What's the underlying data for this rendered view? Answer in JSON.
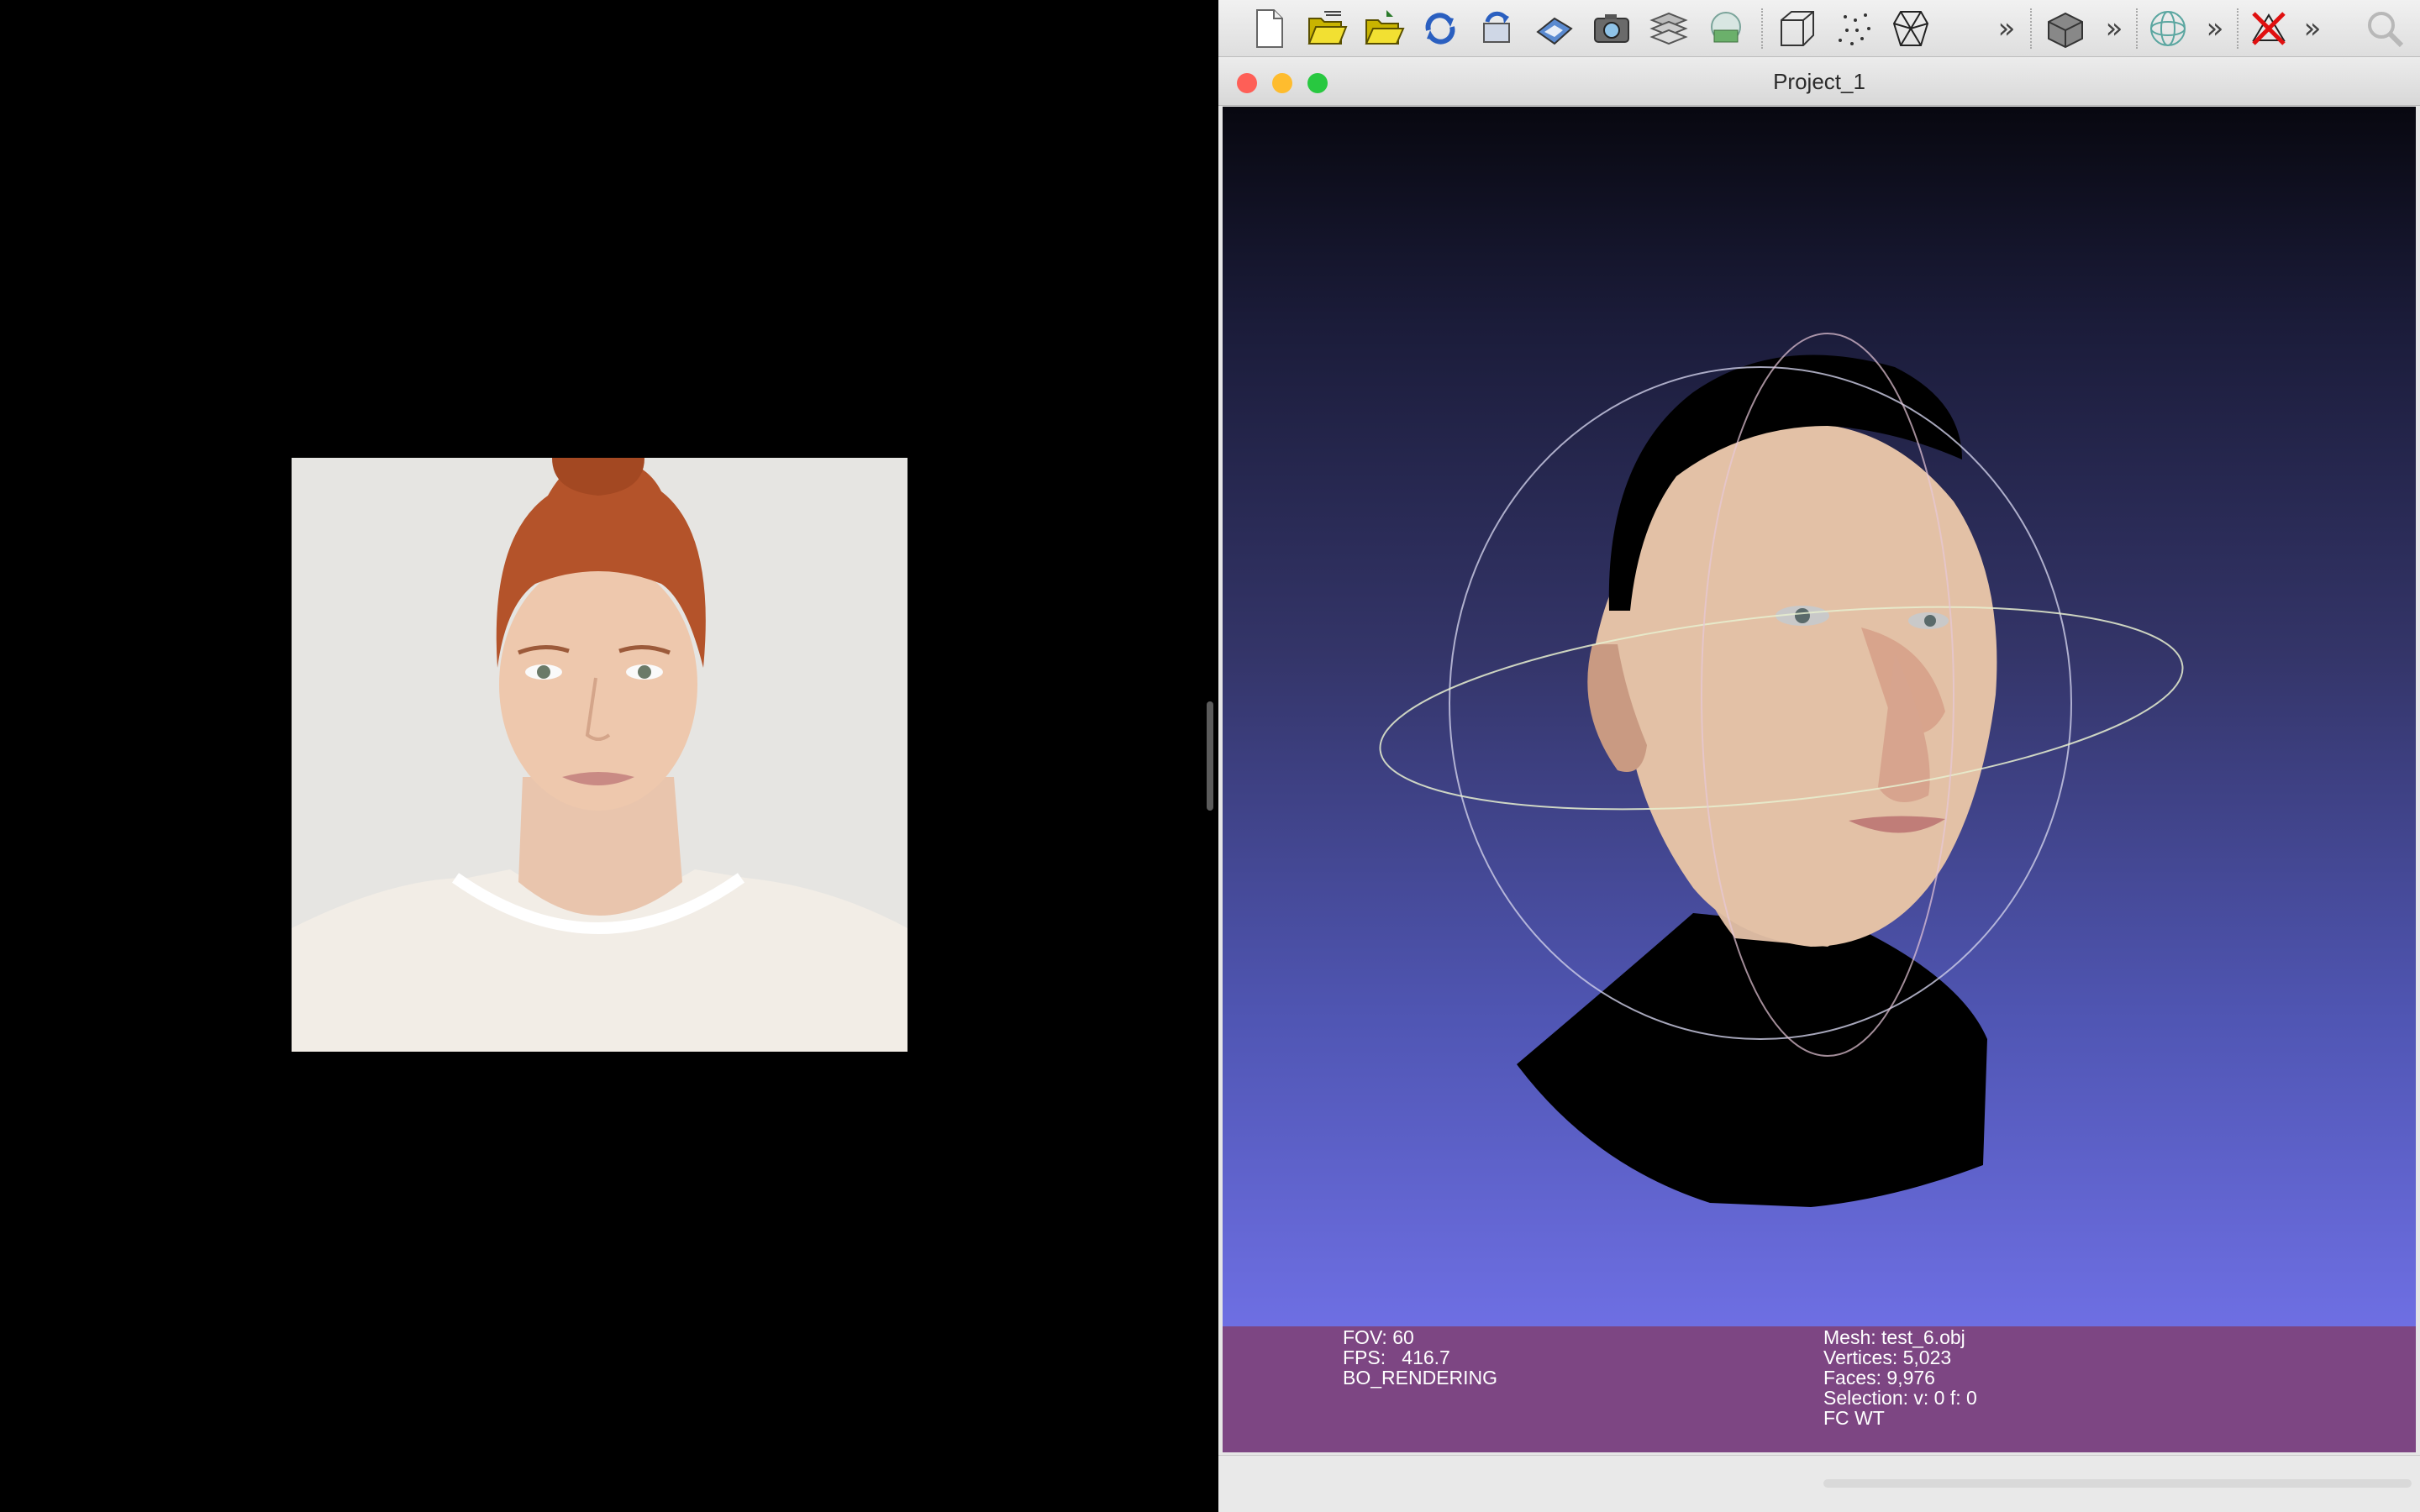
{
  "window": {
    "title": "Project_1"
  },
  "toolbar": {
    "icons": [
      "new-project-icon",
      "open-project-icon",
      "import-mesh-icon",
      "reload-icon",
      "reload-all-icon",
      "save-icon",
      "snapshot-icon",
      "layers-icon",
      "raster-icon",
      "bounding-box-icon",
      "points-icon",
      "wireframe-icon",
      "more-icon",
      "flat-shading-icon",
      "more-icon",
      "trackball-icon",
      "more-icon",
      "delete-selection-icon",
      "more-icon",
      "search-icon"
    ],
    "more_label": "»"
  },
  "viewport": {
    "background_colors": [
      "#080810",
      "#6e6fe3"
    ]
  },
  "info": {
    "fov": "FOV: 60",
    "fps": "FPS:   416.7",
    "render_mode": "BO_RENDERING",
    "mesh": "Mesh: test_6.obj",
    "vertices": "Vertices: 5,023",
    "faces": "Faces: 9,976",
    "selection": "Selection: v: 0 f: 0",
    "flags": "FC WT"
  },
  "colors": {
    "close": "#fe5f57",
    "minimize": "#febc2e",
    "zoom": "#28c840",
    "info_panel": "#7d4683"
  }
}
